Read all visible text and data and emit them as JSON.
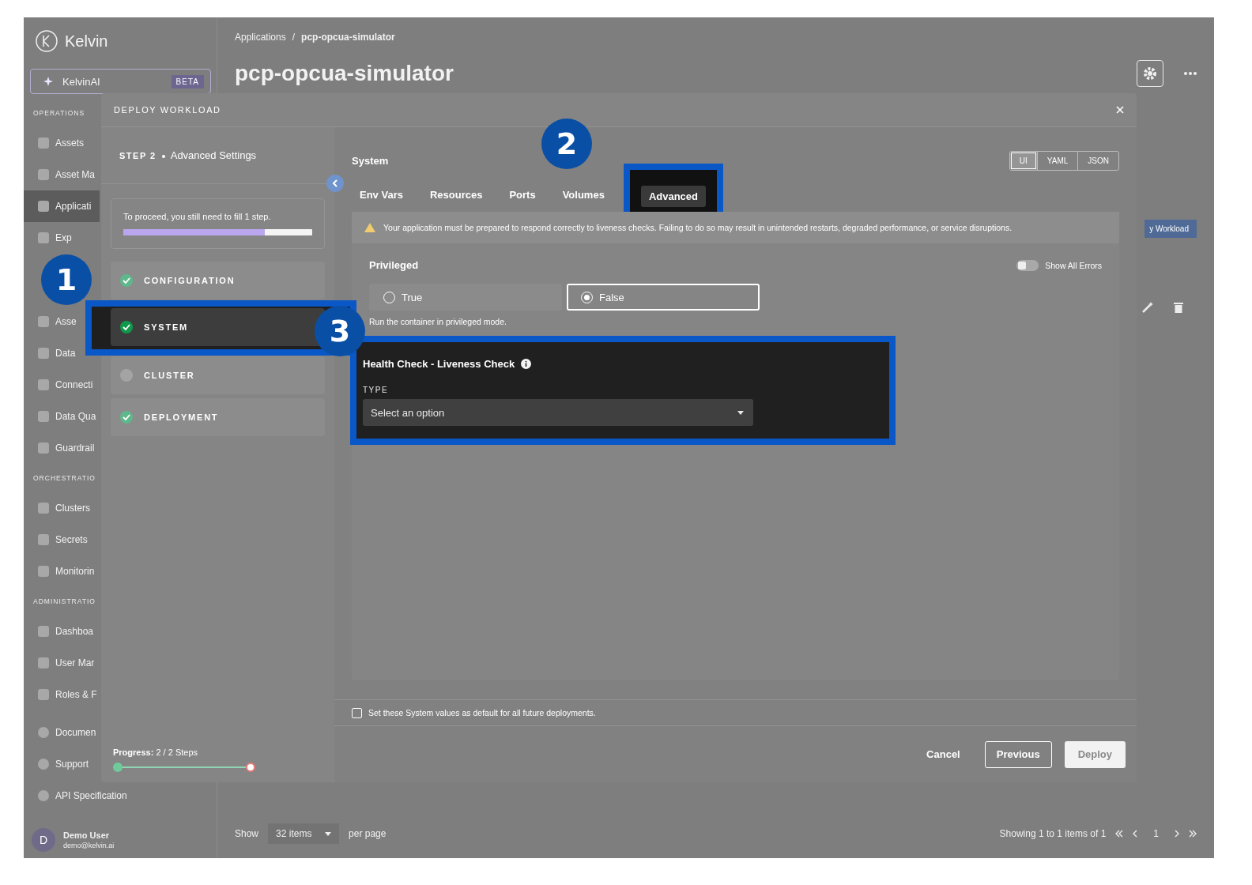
{
  "sidebar": {
    "logo": "Kelvin",
    "ai_button": {
      "label": "KelvinAI",
      "badge": "BETA"
    },
    "sections": [
      {
        "title": "OPERATIONS",
        "items": [
          {
            "label": "Assets",
            "selected": false
          },
          {
            "label": "Asset Ma",
            "selected": false
          },
          {
            "label": "Applicati",
            "selected": true
          },
          {
            "label": "Exp",
            "selected": false
          }
        ]
      },
      {
        "items": [
          {
            "label": "Asse",
            "selected": false
          },
          {
            "label": "Data",
            "selected": false
          },
          {
            "label": "Connecti",
            "selected": false
          },
          {
            "label": "Data Qua",
            "selected": false
          },
          {
            "label": "Guardrail",
            "selected": false
          }
        ]
      },
      {
        "title": "ORCHESTRATIO",
        "items": [
          {
            "label": "Clusters",
            "selected": false
          },
          {
            "label": "Secrets",
            "selected": false
          },
          {
            "label": "Monitorin",
            "selected": false
          }
        ]
      },
      {
        "title": "ADMINISTRATIO",
        "items": [
          {
            "label": "Dashboa",
            "selected": false
          },
          {
            "label": "User Mar",
            "selected": false
          },
          {
            "label": "Roles & F",
            "selected": false
          }
        ]
      }
    ],
    "bottom_items": [
      {
        "label": "Documen"
      },
      {
        "label": "Support"
      },
      {
        "label": "API Specification"
      }
    ],
    "user": {
      "initial": "D",
      "name": "Demo User",
      "email": "demo@kelvin.ai"
    }
  },
  "page": {
    "breadcrumb": [
      "Applications",
      "pcp-opcua-simulator"
    ],
    "breadcrumb_separator": "/",
    "title": "pcp-opcua-simulator",
    "deploy_button": "y Workload",
    "pagination": {
      "show": "Show",
      "per_page_value": "32 items",
      "per_page": "per page",
      "summary": "Showing 1 to 1 items of 1",
      "page": "1"
    }
  },
  "modal": {
    "title": "DEPLOY WORKLOAD",
    "step_label": "STEP 2",
    "step_name": "Advanced Settings",
    "progress_card": {
      "text": "To proceed, you still need to fill 1 step.",
      "level": 0.75
    },
    "steps": [
      {
        "label": "CONFIGURATION",
        "done": true,
        "selected": false
      },
      {
        "label": "SYSTEM",
        "done": true,
        "selected": true
      },
      {
        "label": "CLUSTER",
        "done": false,
        "selected": false
      },
      {
        "label": "DEPLOYMENT",
        "done": true,
        "selected": false
      }
    ],
    "progress": {
      "label": "Progress:",
      "value": "2 / 2 Steps",
      "nodes": [
        {
          "done": true
        },
        {
          "done": false
        }
      ]
    },
    "section_title": "System",
    "view_modes": [
      {
        "label": "UI",
        "selected": true
      },
      {
        "label": "YAML",
        "selected": false
      },
      {
        "label": "JSON",
        "selected": false
      }
    ],
    "tabs": [
      {
        "label": "Env Vars",
        "selected": false
      },
      {
        "label": "Resources",
        "selected": false
      },
      {
        "label": "Ports",
        "selected": false
      },
      {
        "label": "Volumes",
        "selected": false
      },
      {
        "label": "Advanced",
        "selected": true
      }
    ],
    "warning": "Your application must be prepared to respond correctly to liveness checks. Failing to do so may result in unintended restarts, degraded performance, or service disruptions.",
    "privileged": {
      "label": "Privileged",
      "options": [
        {
          "label": "True",
          "selected": false
        },
        {
          "label": "False",
          "selected": true
        }
      ],
      "help": "Run the container in privileged mode."
    },
    "show_all_errors": {
      "label": "Show All Errors",
      "on": false
    },
    "health_check": {
      "title": "Health Check - Liveness Check",
      "type_label": "TYPE",
      "placeholder": "Select an option"
    },
    "default_checkbox": {
      "label": "Set these System values as default for all future deployments.",
      "checked": false
    },
    "buttons": [
      {
        "label": "Cancel",
        "kind": "text",
        "disabled": false
      },
      {
        "label": "Previous",
        "kind": "outline",
        "disabled": false
      },
      {
        "label": "Deploy",
        "kind": "primary",
        "disabled": true
      }
    ]
  },
  "callouts": [
    {
      "number": "1"
    },
    {
      "number": "2"
    },
    {
      "number": "3"
    }
  ]
}
